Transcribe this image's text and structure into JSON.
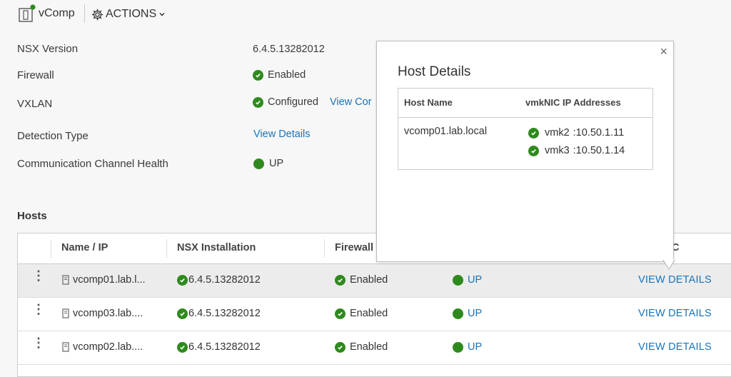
{
  "header": {
    "app_name": "vComp",
    "actions_label": "ACTIONS"
  },
  "properties": {
    "nsx_version": {
      "label": "NSX Version",
      "value": "6.4.5.13282012"
    },
    "firewall": {
      "label": "Firewall",
      "value": "Enabled"
    },
    "vxlan": {
      "label": "VXLAN",
      "value": "Configured",
      "link": "View Cor"
    },
    "detection_type": {
      "label": "Detection Type",
      "link": "View Details"
    },
    "channel_health": {
      "label": "Communication Channel Health",
      "value": "UP"
    }
  },
  "hosts": {
    "title": "Hosts",
    "columns": [
      "Name / IP",
      "NSX Installation",
      "Firewall",
      "C"
    ],
    "rows": [
      {
        "name": "vcomp01.lab.l...",
        "nsx": "6.4.5.13282012",
        "firewall": "Enabled",
        "status": "UP",
        "action": "VIEW DETAILS"
      },
      {
        "name": "vcomp03.lab....",
        "nsx": "6.4.5.13282012",
        "firewall": "Enabled",
        "status": "UP",
        "action": "VIEW DETAILS"
      },
      {
        "name": "vcomp02.lab....",
        "nsx": "6.4.5.13282012",
        "firewall": "Enabled",
        "status": "UP",
        "action": "VIEW DETAILS"
      }
    ]
  },
  "popover": {
    "title": "Host Details",
    "close": "×",
    "col_host": "Host Name",
    "col_ips": "vmkNIC IP Addresses",
    "host": "vcomp01.lab.local",
    "ips": [
      {
        "nic": "vmk2",
        "ip": ":10.50.1.11"
      },
      {
        "nic": "vmk3",
        "ip": ":10.50.1.14"
      }
    ]
  },
  "colors": {
    "ok": "#2f8a1e",
    "link": "#1a73b8"
  },
  "icons": [
    "cluster-icon",
    "gear-icon",
    "chevron-down-icon",
    "check-icon",
    "host-icon",
    "kebab-icon",
    "close-icon"
  ]
}
